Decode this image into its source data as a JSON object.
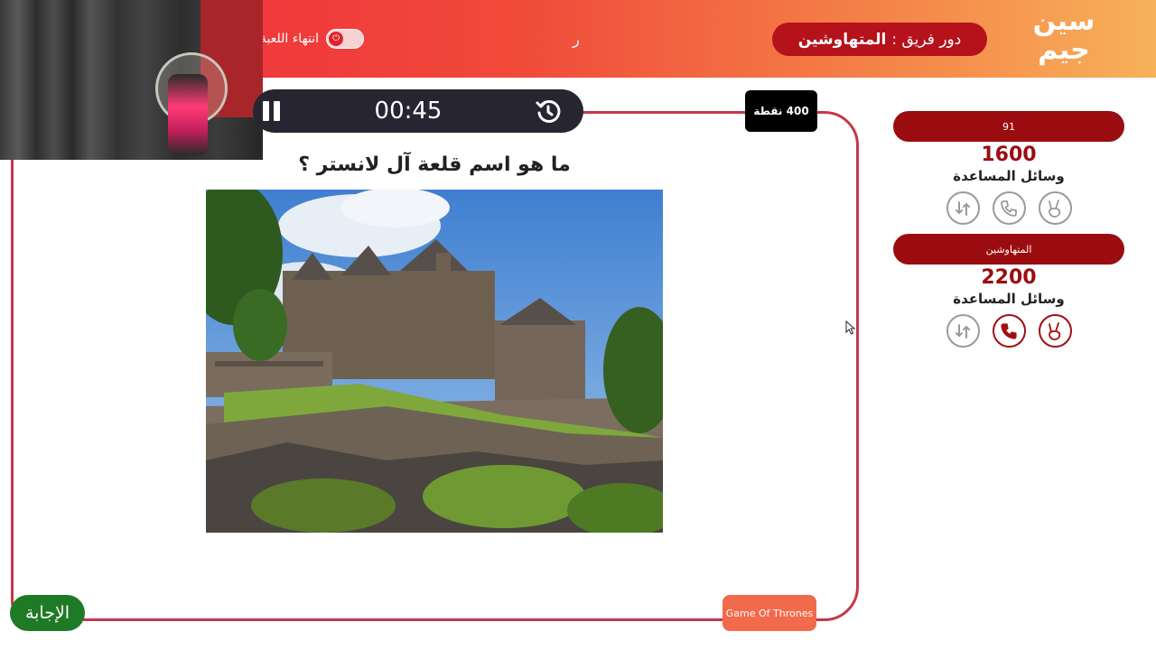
{
  "header": {
    "logo_line1": "سين",
    "logo_line2": "جيم",
    "turn_prefix": "دور فريق :",
    "turn_team": "المتهاوشين",
    "center_mark": "ر",
    "end_game_label": "انتهاء اللعبة"
  },
  "timer": {
    "time": "00:45"
  },
  "question": {
    "points": "400 نقطة",
    "text": "ما هو اسم قلعة آل لانستر ؟",
    "category": "Game Of Thrones",
    "answer_label": "الإجابة"
  },
  "teams": [
    {
      "name": "91",
      "score": "1600",
      "aids_label": "وسائل المساعدة",
      "aids": [
        {
          "icon": "peace-hand-icon",
          "active": false
        },
        {
          "icon": "phone-icon",
          "active": false
        },
        {
          "icon": "swap-icon",
          "active": false
        }
      ]
    },
    {
      "name": "المتهاوشين",
      "score": "2200",
      "aids_label": "وسائل المساعدة",
      "aids": [
        {
          "icon": "peace-hand-icon",
          "active": true
        },
        {
          "icon": "phone-icon",
          "active": true
        },
        {
          "icon": "swap-icon",
          "active": false
        }
      ]
    }
  ],
  "colors": {
    "accent_red": "#9b0c10",
    "frame_border": "#c8364a",
    "timer_bg": "#262531",
    "answer_green": "#1f7a25",
    "category_orange": "#f26a4c"
  }
}
